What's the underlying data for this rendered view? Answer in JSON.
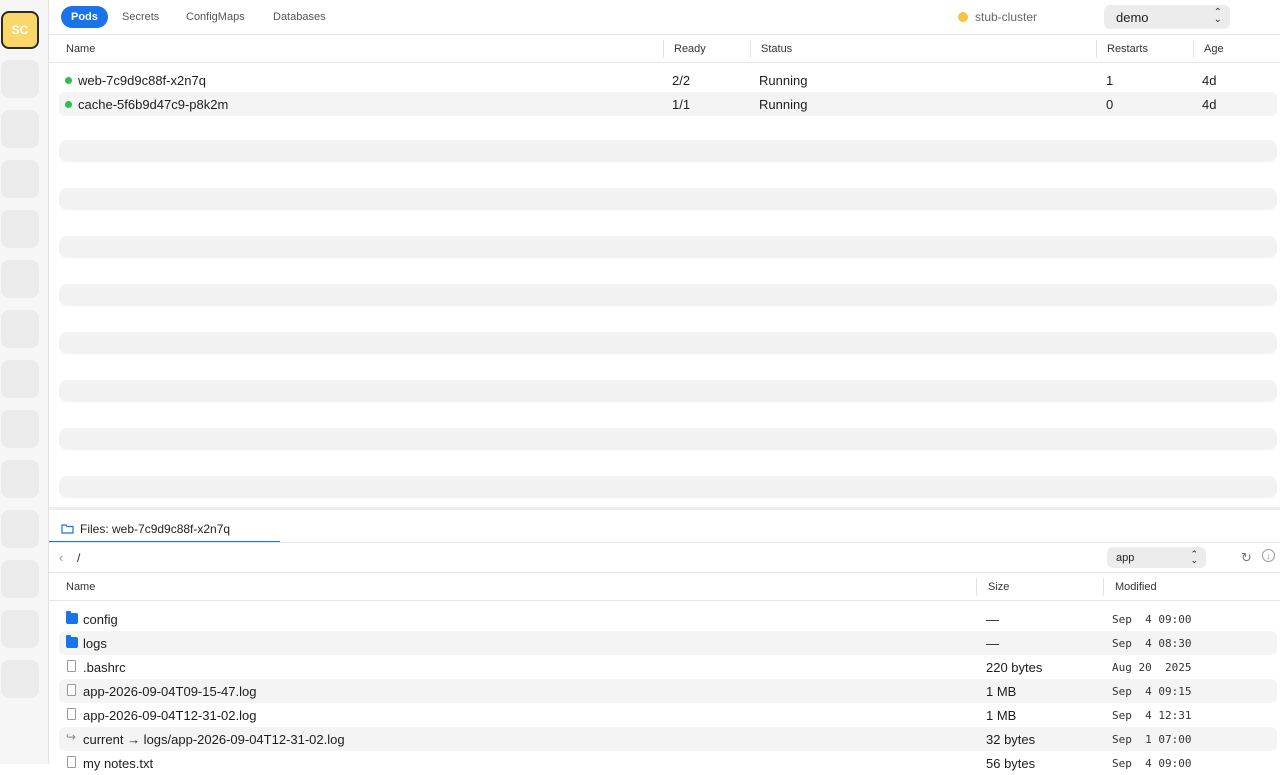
{
  "sidebar": {
    "avatar": "SC",
    "slot_count": 13
  },
  "tabs": [
    {
      "label": "Pods",
      "active": true
    },
    {
      "label": "Secrets",
      "active": false
    },
    {
      "label": "ConfigMaps",
      "active": false
    },
    {
      "label": "Databases",
      "active": false
    }
  ],
  "cluster": {
    "name": "stub-cluster",
    "status_color": "#f5c542"
  },
  "namespace": {
    "selected": "demo"
  },
  "pods": {
    "columns": {
      "name": "Name",
      "ready": "Ready",
      "status": "Status",
      "restarts": "Restarts",
      "age": "Age"
    },
    "rows": [
      {
        "name": "web-7c9d9c88f-x2n7q",
        "ready": "2/2",
        "status": "Running",
        "restarts": "1",
        "age": "4d"
      },
      {
        "name": "cache-5f6b9d47c9-p8k2m",
        "ready": "1/1",
        "status": "Running",
        "restarts": "0",
        "age": "4d"
      }
    ],
    "placeholder_rows": 8
  },
  "files": {
    "tab_label": "Files: web-7c9d9c88f-x2n7q",
    "path": "/",
    "container": "app",
    "columns": {
      "name": "Name",
      "size": "Size",
      "modified": "Modified"
    },
    "rows": [
      {
        "type": "folder",
        "icon": "folder-icon",
        "name": "config",
        "size": "—",
        "modified": "Sep  4 09:00"
      },
      {
        "type": "folder",
        "icon": "folder-icon",
        "name": "logs",
        "size": "—",
        "modified": "Sep  4 08:30"
      },
      {
        "type": "file",
        "icon": "file-icon",
        "name": ".bashrc",
        "size": "220 bytes",
        "modified": "Aug 20  2025"
      },
      {
        "type": "file",
        "icon": "file-icon",
        "name": "app-2026-09-04T09-15-47.log",
        "size": "1 MB",
        "modified": "Sep  4 09:15"
      },
      {
        "type": "file",
        "icon": "file-icon",
        "name": "app-2026-09-04T12-31-02.log",
        "size": "1 MB",
        "modified": "Sep  4 12:31"
      },
      {
        "type": "link",
        "icon": "symlink-icon",
        "name": "current → logs/app-2026-09-04T12-31-02.log",
        "size": "32 bytes",
        "modified": "Sep  1 07:00"
      },
      {
        "type": "file",
        "icon": "file-icon",
        "name": "my notes.txt",
        "size": "56 bytes",
        "modified": "Sep  4 09:00"
      }
    ]
  },
  "colors": {
    "accent": "#1a73e8",
    "running": "#2dbe4e",
    "avatar": "#fbd66a"
  }
}
